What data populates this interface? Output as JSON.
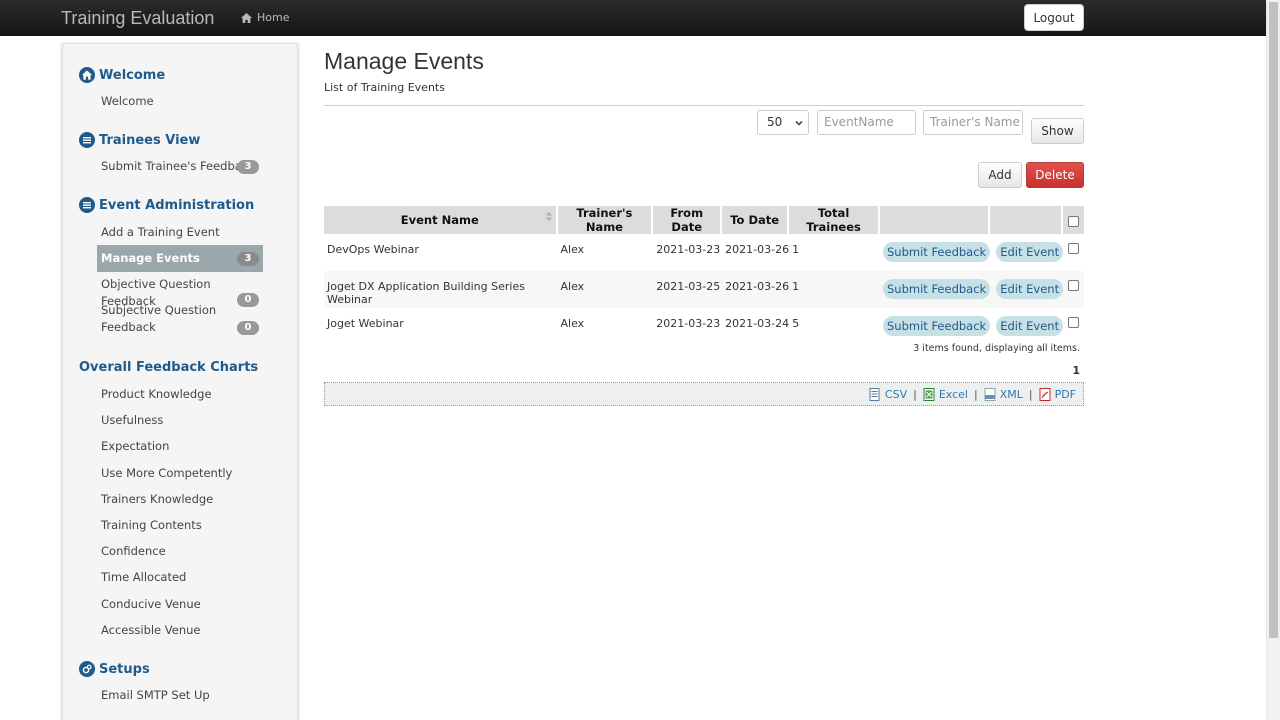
{
  "header": {
    "app_title": "Training Evaluation",
    "home_label": "Home",
    "logout_label": "Logout"
  },
  "sidebar": {
    "sections": [
      {
        "title": "Welcome",
        "icon": "home-icon",
        "items": [
          {
            "label": "Welcome"
          }
        ]
      },
      {
        "title": "Trainees View",
        "icon": "list-icon",
        "items": [
          {
            "label": "Submit Trainee's Feedback",
            "badge": "3"
          }
        ]
      },
      {
        "title": "Event Administration",
        "icon": "list-icon",
        "items": [
          {
            "label": "Add a Training Event"
          },
          {
            "label": "Manage Events",
            "badge": "3",
            "active": true
          },
          {
            "label": "Objective Question Feedback",
            "badge": "0"
          },
          {
            "label": "Subjective Question Feedback",
            "badge": "0"
          }
        ]
      },
      {
        "title": "Overall Feedback Charts",
        "icon": "",
        "items": [
          {
            "label": "Product Knowledge"
          },
          {
            "label": "Usefulness"
          },
          {
            "label": "Expectation"
          },
          {
            "label": "Use More Competently"
          },
          {
            "label": "Trainers Knowledge"
          },
          {
            "label": "Training Contents"
          },
          {
            "label": "Confidence"
          },
          {
            "label": "Time Allocated"
          },
          {
            "label": "Conducive Venue"
          },
          {
            "label": "Accessible Venue"
          }
        ]
      },
      {
        "title": "Setups",
        "icon": "gears-icon",
        "items": [
          {
            "label": "Email SMTP Set Up"
          }
        ]
      }
    ]
  },
  "main": {
    "title": "Manage Events",
    "subtitle": "List of Training Events",
    "page_size": "50",
    "event_name_placeholder": "EventName",
    "trainer_placeholder": "Trainer's Name",
    "show_label": "Show",
    "add_label": "Add",
    "delete_label": "Delete",
    "columns": [
      "Event Name",
      "Trainer's Name",
      "From Date",
      "To Date",
      "Total Trainees"
    ],
    "rows": [
      {
        "event": "DevOps Webinar",
        "trainer": "Alex",
        "from": "2021-03-23",
        "to": "2021-03-26",
        "total": "1"
      },
      {
        "event": "Joget DX Application Building Series Webinar",
        "trainer": "Alex",
        "from": "2021-03-25",
        "to": "2021-03-26",
        "total": "1"
      },
      {
        "event": "Joget Webinar",
        "trainer": "Alex",
        "from": "2021-03-23",
        "to": "2021-03-24",
        "total": "5"
      }
    ],
    "submit_feedback_label": "Submit Feedback",
    "edit_event_label": "Edit Event",
    "summary": "3 items found, displaying all items.",
    "page": "1",
    "exports": [
      "CSV",
      "Excel",
      "XML",
      "PDF"
    ]
  },
  "colors": {
    "accent": "#1f5a8c",
    "delete": "#d9534f",
    "active_nav": "#9aa7ab",
    "pill": "#c6e0e6"
  }
}
